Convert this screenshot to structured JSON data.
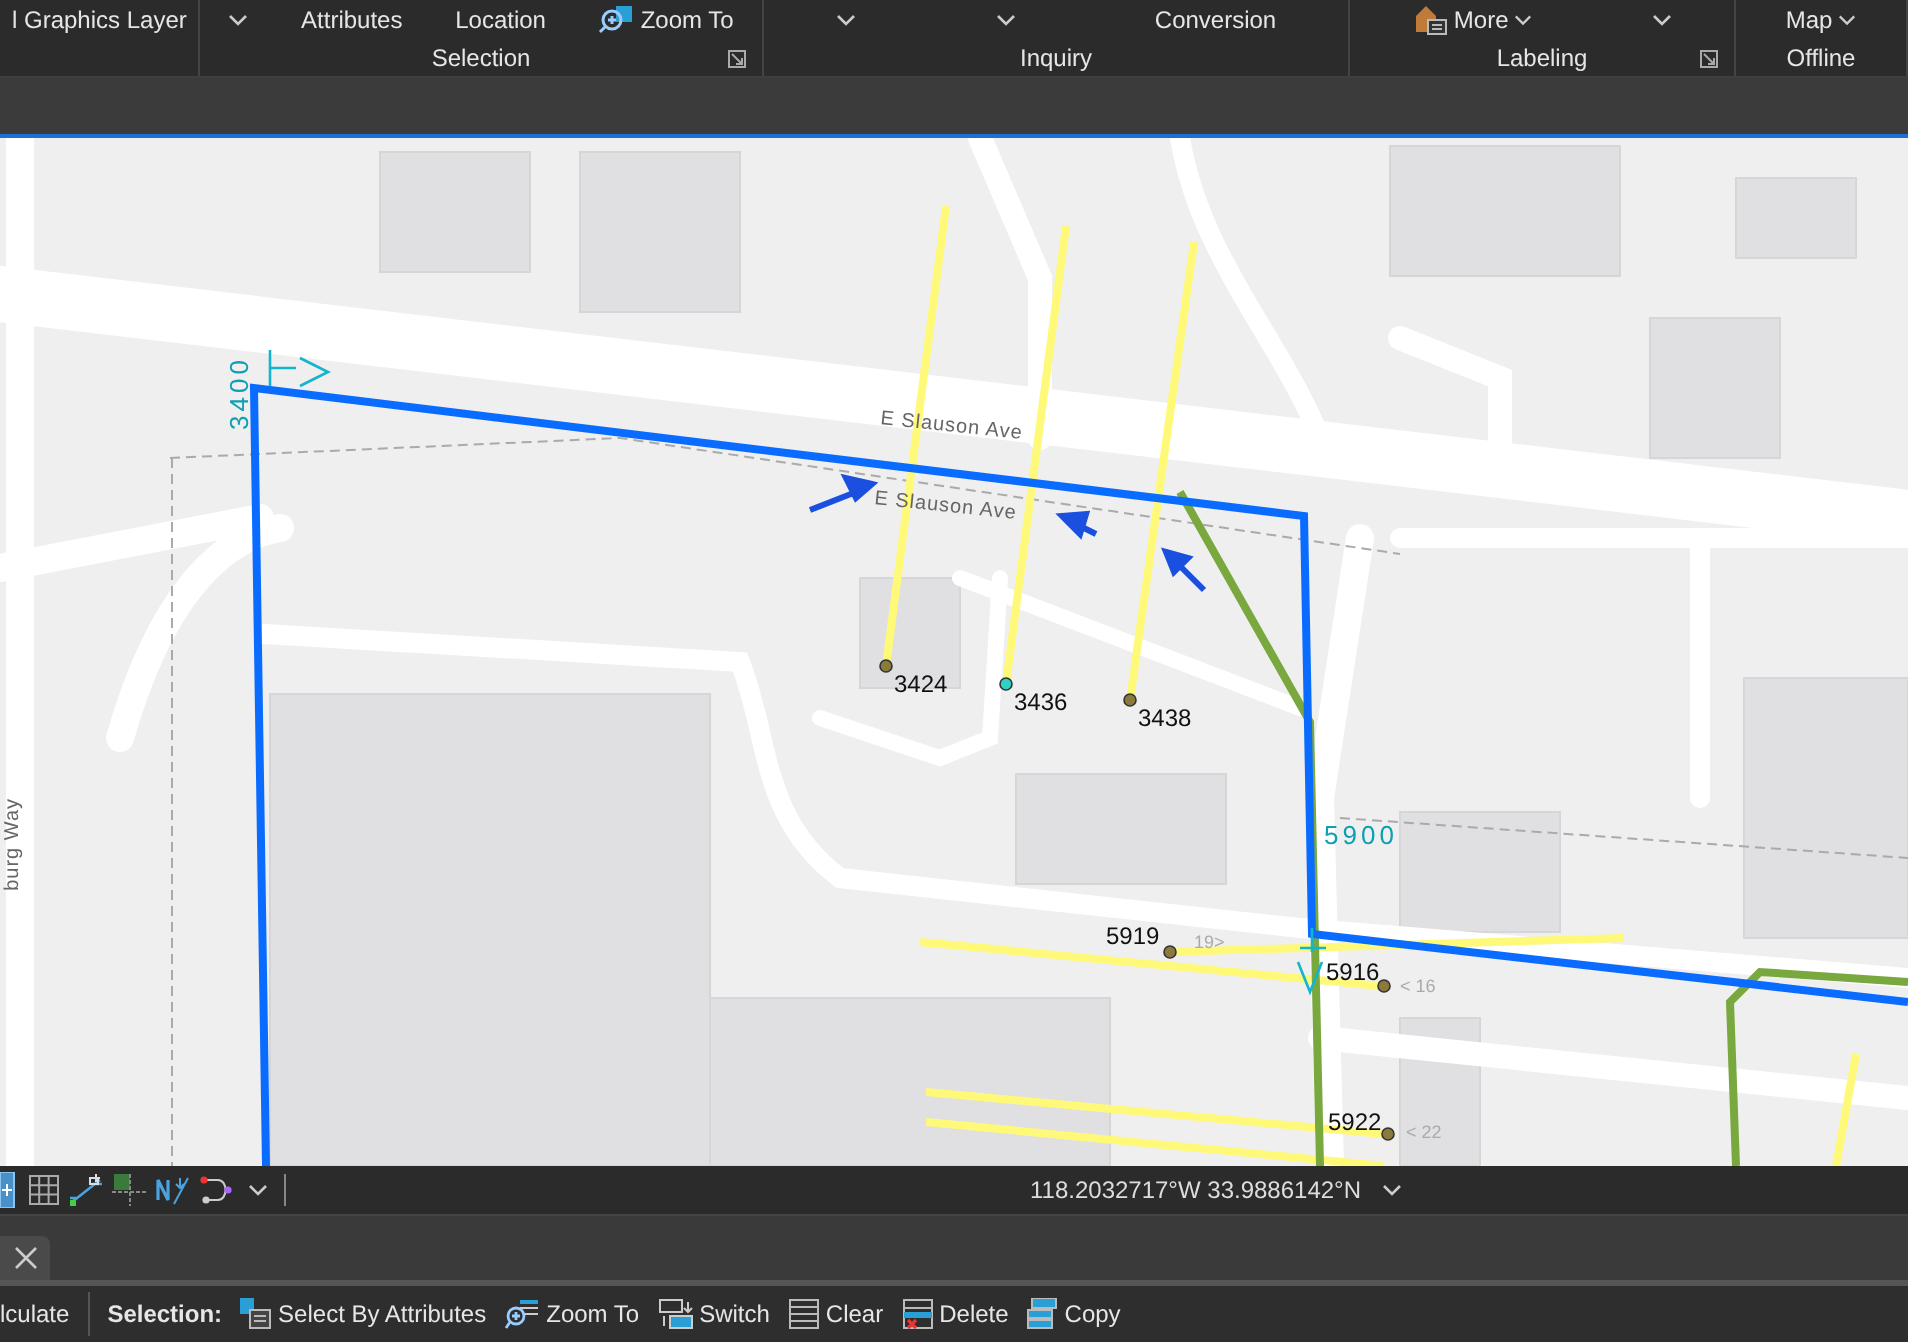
{
  "ribbon": {
    "groups": [
      {
        "commands": [
          {
            "kind": "text",
            "label": "l Graphics Layer"
          }
        ],
        "launcher": false
      },
      {
        "label": "Selection",
        "launcher": true,
        "commands": [
          {
            "kind": "chevron"
          },
          {
            "kind": "text",
            "label": "Attributes"
          },
          {
            "kind": "text",
            "label": "Location"
          },
          {
            "kind": "zoom",
            "label": "Zoom To"
          }
        ]
      },
      {
        "label": "Inquiry",
        "launcher": false,
        "commands": [
          {
            "kind": "chevron"
          },
          {
            "kind": "chevron"
          },
          {
            "kind": "text",
            "label": "Conversion"
          }
        ]
      },
      {
        "label": "Labeling",
        "launcher": true,
        "commands": [
          {
            "kind": "labels",
            "label": "More"
          },
          {
            "kind": "chevron"
          }
        ]
      },
      {
        "label": "Offline",
        "launcher": false,
        "commands": [
          {
            "kind": "menu",
            "label": "Map"
          }
        ]
      }
    ]
  },
  "map": {
    "streets": [
      "E Slauson Ave",
      "E Slauson Ave",
      "burg Way"
    ],
    "ranges": [
      "3400",
      "5900"
    ],
    "addresses": [
      {
        "label": "3424",
        "color": "#8a7a3c"
      },
      {
        "label": "3436",
        "color": "#2ed1c4"
      },
      {
        "label": "3438",
        "color": "#8a7a3c"
      },
      {
        "label": "5919",
        "color": "#8a7a3c"
      },
      {
        "label": "5916",
        "color": "#8a7a3c"
      },
      {
        "label": "5922",
        "color": "#8a7a3c"
      }
    ],
    "house_numbers": [
      "19>",
      "< 16",
      "< 22"
    ]
  },
  "status_bar": {
    "coordinates": "118.2032717°W 33.9886142°N"
  },
  "table_toolbar": [
    {
      "kind": "text",
      "label": "lculate"
    },
    {
      "kind": "heading",
      "label": "Selection:"
    },
    {
      "kind": "select",
      "label": "Select By Attributes"
    },
    {
      "kind": "zoom",
      "label": "Zoom To"
    },
    {
      "kind": "switch",
      "label": "Switch"
    },
    {
      "kind": "clear",
      "label": "Clear"
    },
    {
      "kind": "delete",
      "label": "Delete"
    },
    {
      "kind": "copy",
      "label": "Copy"
    }
  ]
}
